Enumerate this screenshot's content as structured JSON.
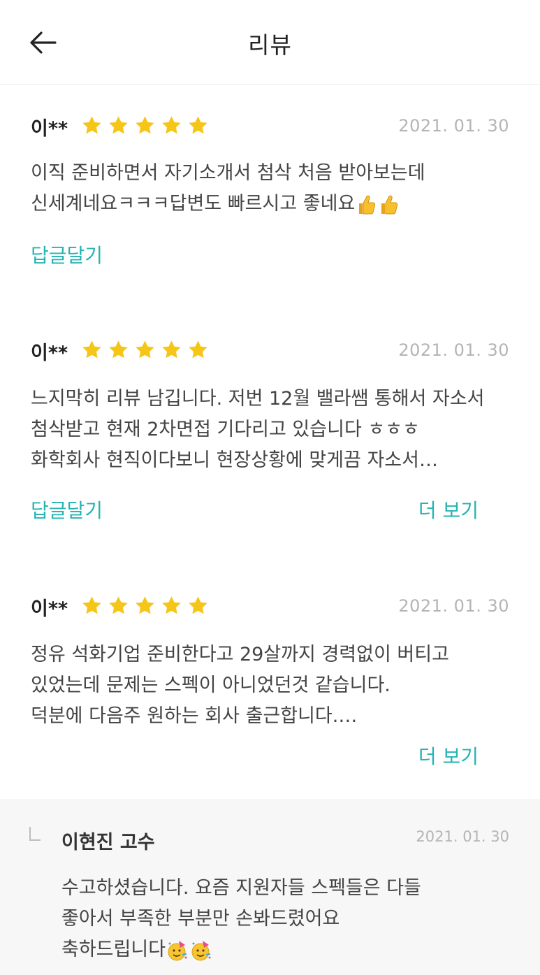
{
  "header": {
    "title": "리뷰",
    "back_icon": "arrow-left-icon"
  },
  "colors": {
    "accent": "#26b3b3",
    "star": "#f5c518",
    "date": "#b4b4b4",
    "reply_bg": "#f7f7f7"
  },
  "reviews": [
    {
      "author": "이**",
      "rating": 5,
      "date": "2021. 01. 30",
      "lines": [
        "이직 준비하면서 자기소개서 첨삭 처음 받아보는데",
        "신세계네요ㅋㅋㅋ답변도 빠르시고 좋네요"
      ],
      "emoji": "thumbs-up-icon",
      "reply_label": "답글달기"
    },
    {
      "author": "이**",
      "rating": 5,
      "date": "2021. 01. 30",
      "lines": [
        "느지막히 리뷰 남깁니다. 저번 12월 밸라쌤 통해서 자소서",
        "첨삭받고 현재 2차면접 기다리고 있습니다 ㅎㅎㅎ",
        "화학회사 현직이다보니 현장상황에 맞게끔 자소서…"
      ],
      "reply_label": "답글달기",
      "more_label": "더 보기"
    },
    {
      "author": "이**",
      "rating": 5,
      "date": "2021. 01. 30",
      "lines": [
        "정유 석화기업 준비한다고 29살까지 경력없이 버티고",
        "있었는데 문제는 스펙이 아니었던것 같습니다.",
        "덕분에 다음주 원하는 회사 출근합니다.…"
      ],
      "more_label": "더 보기"
    }
  ],
  "reply": {
    "author": "이현진 고수",
    "date": "2021. 01. 30",
    "lines": [
      "수고하셨습니다. 요즘 지원자들 스펙들은 다들",
      "좋아서 부족한 부분만 손봐드렸어요",
      "축하드립니다"
    ],
    "emoji": "party-face-icon"
  }
}
